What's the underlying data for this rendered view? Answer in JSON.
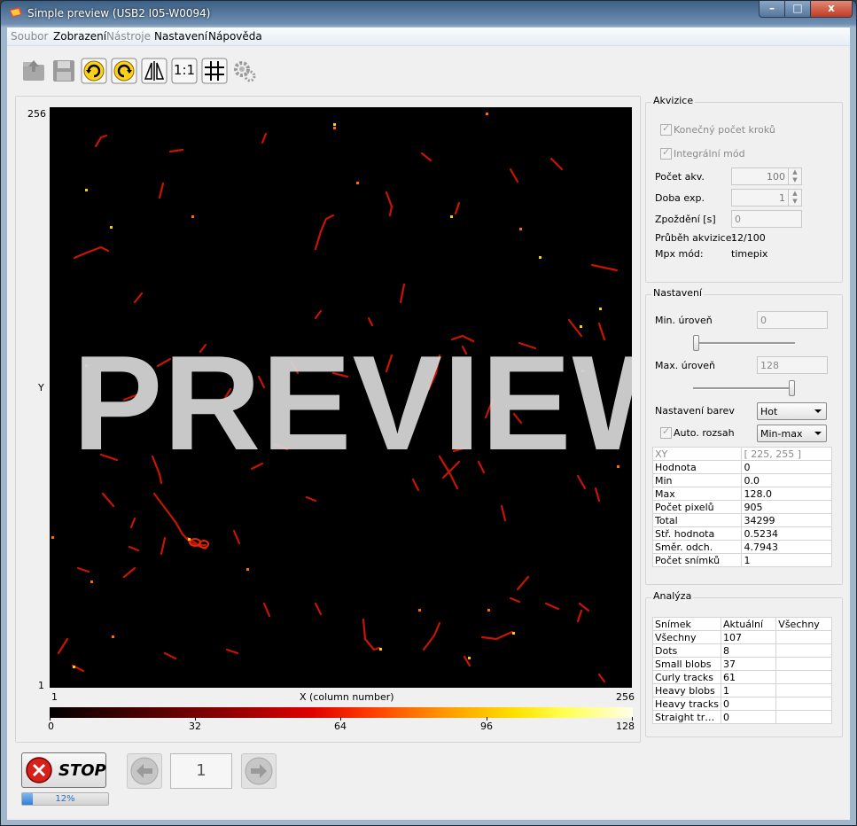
{
  "window": {
    "title": "Simple preview (USB2 I05-W0094)",
    "minimize": "–",
    "maximize": "□",
    "close": "x"
  },
  "menu": [
    {
      "label": "Soubor",
      "enabled": false
    },
    {
      "label": "Zobrazení",
      "enabled": true
    },
    {
      "label": "Nástroje",
      "enabled": false
    },
    {
      "label": "Nastavení",
      "enabled": true
    },
    {
      "label": "Nápověda",
      "enabled": true
    }
  ],
  "toolbar": [
    "open-icon",
    "save-icon",
    "rotate-cw-icon",
    "rotate-ccw-icon",
    "flip-icon",
    "one-to-one-icon",
    "grid-icon",
    "settings-gear-icon"
  ],
  "toolbar_one_to_one_label": "1:1",
  "plot": {
    "y_top": "256",
    "y_mid": "Y",
    "y_bottom": "1",
    "x_left": "1",
    "x_label": "X (column number)",
    "x_right": "256",
    "watermark": "PREVIEW",
    "colorbar_ticks": [
      "0",
      "32",
      "64",
      "96",
      "128"
    ],
    "colormap": "Hot"
  },
  "akvizice": {
    "title": "Akvizice",
    "konecny_pocet": "Konečný počet kroků",
    "integralni": "Integrální mód",
    "pocet_akv_label": "Počet akv.",
    "pocet_akv_value": "100",
    "doba_exp_label": "Doba exp.",
    "doba_exp_value": "1",
    "zpozdeni_label": "Zpoždění [s]",
    "zpozdeni_value": "0",
    "prubeh_label": "Průběh akvizice:",
    "prubeh_value": "12/100",
    "mpx_label": "Mpx mód:",
    "mpx_value": "timepix"
  },
  "nastaveni": {
    "title": "Nastavení",
    "min_label": "Min. úroveň",
    "min_value": "0",
    "min_slider": 0.0,
    "max_label": "Max. úroveň",
    "max_value": "128",
    "max_slider": 1.0,
    "barvy_label": "Nastavení barev",
    "barvy_value": "Hot",
    "auto_label": "Auto. rozsah",
    "auto_value": "Min-max"
  },
  "stats": [
    [
      "XY",
      "[ 225, 255 ]"
    ],
    [
      "Hodnota",
      "0"
    ],
    [
      "Min",
      "0.0"
    ],
    [
      "Max",
      "128.0"
    ],
    [
      "Počet pixelů",
      "905"
    ],
    [
      "Total",
      "34299"
    ],
    [
      "Stř. hodnota",
      "0.5234"
    ],
    [
      "Směr. odch.",
      "4.7943"
    ],
    [
      "Počet snímků",
      "1"
    ]
  ],
  "analyza": {
    "title": "Analýza",
    "headers": [
      "Snímek",
      "Aktuální",
      "Všechny"
    ],
    "rows": [
      [
        "Všechny",
        "107",
        ""
      ],
      [
        "Dots",
        "8",
        ""
      ],
      [
        "Small blobs",
        "37",
        ""
      ],
      [
        "Curly tracks",
        "61",
        ""
      ],
      [
        "Heavy blobs",
        "1",
        ""
      ],
      [
        "Heavy tracks",
        "0",
        ""
      ],
      [
        "Straight tr…",
        "0",
        ""
      ]
    ]
  },
  "controls": {
    "stop_label": "STOP",
    "progress_text": "12%",
    "progress_value": 0.12,
    "frame_number": "1"
  }
}
